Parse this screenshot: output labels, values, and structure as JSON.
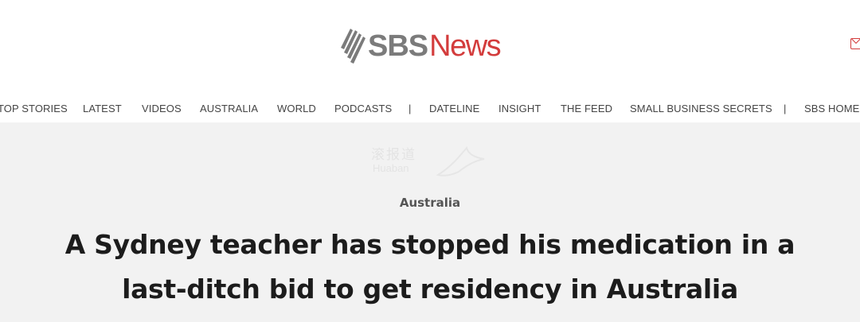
{
  "header": {
    "logo_sbs": "SBS",
    "logo_news": "News",
    "icons": [
      "sbs-wings-logo-icon",
      "mail-icon"
    ],
    "colors": {
      "brand_gray": "#7b7b7b",
      "brand_red": "#d33c3c"
    }
  },
  "nav": {
    "items": [
      "TOP STORIES",
      "LATEST",
      "VIDEOS",
      "AUSTRALIA",
      "WORLD",
      "PODCASTS",
      "DATELINE",
      "INSIGHT",
      "THE FEED",
      "SMALL BUSINESS SECRETS",
      "SBS HOME"
    ],
    "separator": "|"
  },
  "watermark": {
    "cn": "滚报道",
    "en": "Huaban"
  },
  "article": {
    "category": "Australia",
    "headline": "A Sydney teacher has stopped his medication in a last-ditch bid to get residency in Australia"
  }
}
